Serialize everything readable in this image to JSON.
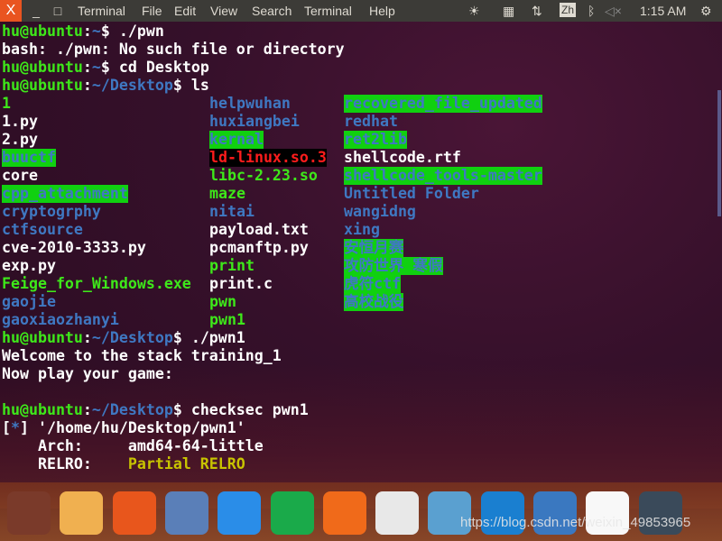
{
  "menubar": {
    "items": [
      "Terminal",
      "File",
      "Edit",
      "View",
      "Search",
      "Terminal",
      "Help"
    ],
    "close": "X",
    "minimize": "_",
    "maximize": "□",
    "input_method": "Zh",
    "clock": "1:15 AM"
  },
  "prompt": {
    "user": "hu@ubuntu",
    "sep": ":",
    "home": "~",
    "desktop": "~/Desktop"
  },
  "lines": [
    {
      "kind": "prompt",
      "dir": "home",
      "cmd": "$ ./pwn"
    },
    {
      "kind": "text",
      "text": "bash: ./pwn: No such file or directory"
    },
    {
      "kind": "prompt",
      "dir": "home",
      "cmd": "$ cd Desktop"
    },
    {
      "kind": "prompt",
      "dir": "desktop",
      "cmd": "$ ls"
    }
  ],
  "ls": {
    "columns": [
      [
        {
          "n": "1",
          "t": "ex"
        },
        {
          "n": "1.py",
          "t": "w"
        },
        {
          "n": "2.py",
          "t": "w"
        },
        {
          "n": "buuctf",
          "t": "ow"
        },
        {
          "n": "core",
          "t": "w"
        },
        {
          "n": "cpp_attachment",
          "t": "ow"
        },
        {
          "n": "cryptogrphy",
          "t": "b"
        },
        {
          "n": "ctfsource",
          "t": "b"
        },
        {
          "n": "cve-2010-3333.py",
          "t": "w"
        },
        {
          "n": "exp.py",
          "t": "w"
        },
        {
          "n": "Feige_for_Windows.exe",
          "t": "ex"
        },
        {
          "n": "gaojie",
          "t": "b"
        },
        {
          "n": "gaoxiaozhanyi",
          "t": "b"
        }
      ],
      [
        {
          "n": "helpwuhan",
          "t": "b"
        },
        {
          "n": "huxiangbei",
          "t": "b"
        },
        {
          "n": "kernal",
          "t": "ow"
        },
        {
          "n": "ld-linux.so.3",
          "t": "bl"
        },
        {
          "n": "libc-2.23.so",
          "t": "ex"
        },
        {
          "n": "maze",
          "t": "ex"
        },
        {
          "n": "nitai",
          "t": "b"
        },
        {
          "n": "payload.txt",
          "t": "w"
        },
        {
          "n": "pcmanftp.py",
          "t": "w"
        },
        {
          "n": "print",
          "t": "ex"
        },
        {
          "n": "print.c",
          "t": "w"
        },
        {
          "n": "pwn",
          "t": "ex"
        },
        {
          "n": "pwn1",
          "t": "ex"
        }
      ],
      [
        {
          "n": "recovered_file_updated",
          "t": "ow"
        },
        {
          "n": "redhat",
          "t": "b"
        },
        {
          "n": "ret2lib",
          "t": "ow"
        },
        {
          "n": "shellcode.rtf",
          "t": "w"
        },
        {
          "n": "shellcode_tools-master",
          "t": "ow"
        },
        {
          "n": "Untitled Folder",
          "t": "b"
        },
        {
          "n": "wangidng",
          "t": "b"
        },
        {
          "n": "xing",
          "t": "b"
        },
        {
          "n": "安恒月赛",
          "t": "ow"
        },
        {
          "n": "攻防世界 寒假",
          "t": "ow"
        },
        {
          "n": "虎符ctf",
          "t": "ow"
        },
        {
          "n": "高校战役",
          "t": "ow"
        }
      ]
    ]
  },
  "after": [
    {
      "kind": "prompt",
      "dir": "desktop",
      "cmd": "$ ./pwn1"
    },
    {
      "kind": "text",
      "text": "Welcome to the stack training_1"
    },
    {
      "kind": "text",
      "text": "Now play your game:"
    },
    {
      "kind": "text",
      "text": ""
    },
    {
      "kind": "prompt",
      "dir": "desktop",
      "cmd": "$ checksec pwn1"
    },
    {
      "kind": "star",
      "pre": "[",
      "star": "*",
      "post": "] '/home/hu/Desktop/pwn1'"
    },
    {
      "kind": "text",
      "text": "    Arch:     amd64-64-little"
    },
    {
      "kind": "kv",
      "key": "    RELRO:    ",
      "val": "Partial RELRO"
    }
  ],
  "dock": {
    "apps": [
      {
        "name": "ubuntu-dash",
        "color": "#7a3a2a"
      },
      {
        "name": "files",
        "color": "#f0b050"
      },
      {
        "name": "firefox",
        "color": "#e8561c"
      },
      {
        "name": "chromium",
        "color": "#5a7fb8"
      },
      {
        "name": "wps-writer",
        "color": "#2a8de8"
      },
      {
        "name": "wps-spreadsheets",
        "color": "#1aaa4a"
      },
      {
        "name": "wps-presentation",
        "color": "#f06a1a"
      },
      {
        "name": "ubuntu-software",
        "color": "#e8e8e8"
      },
      {
        "name": "feige",
        "color": "#5aa0d0"
      },
      {
        "name": "vscode",
        "color": "#1a7fd0"
      },
      {
        "name": "app-launcher",
        "color": "#3a78c0"
      },
      {
        "name": "ida",
        "color": "#f8f8f8"
      },
      {
        "name": "terminal",
        "color": "#3a4a5a"
      }
    ]
  },
  "watermark": "https://blog.csdn.net/weixin_49853965"
}
